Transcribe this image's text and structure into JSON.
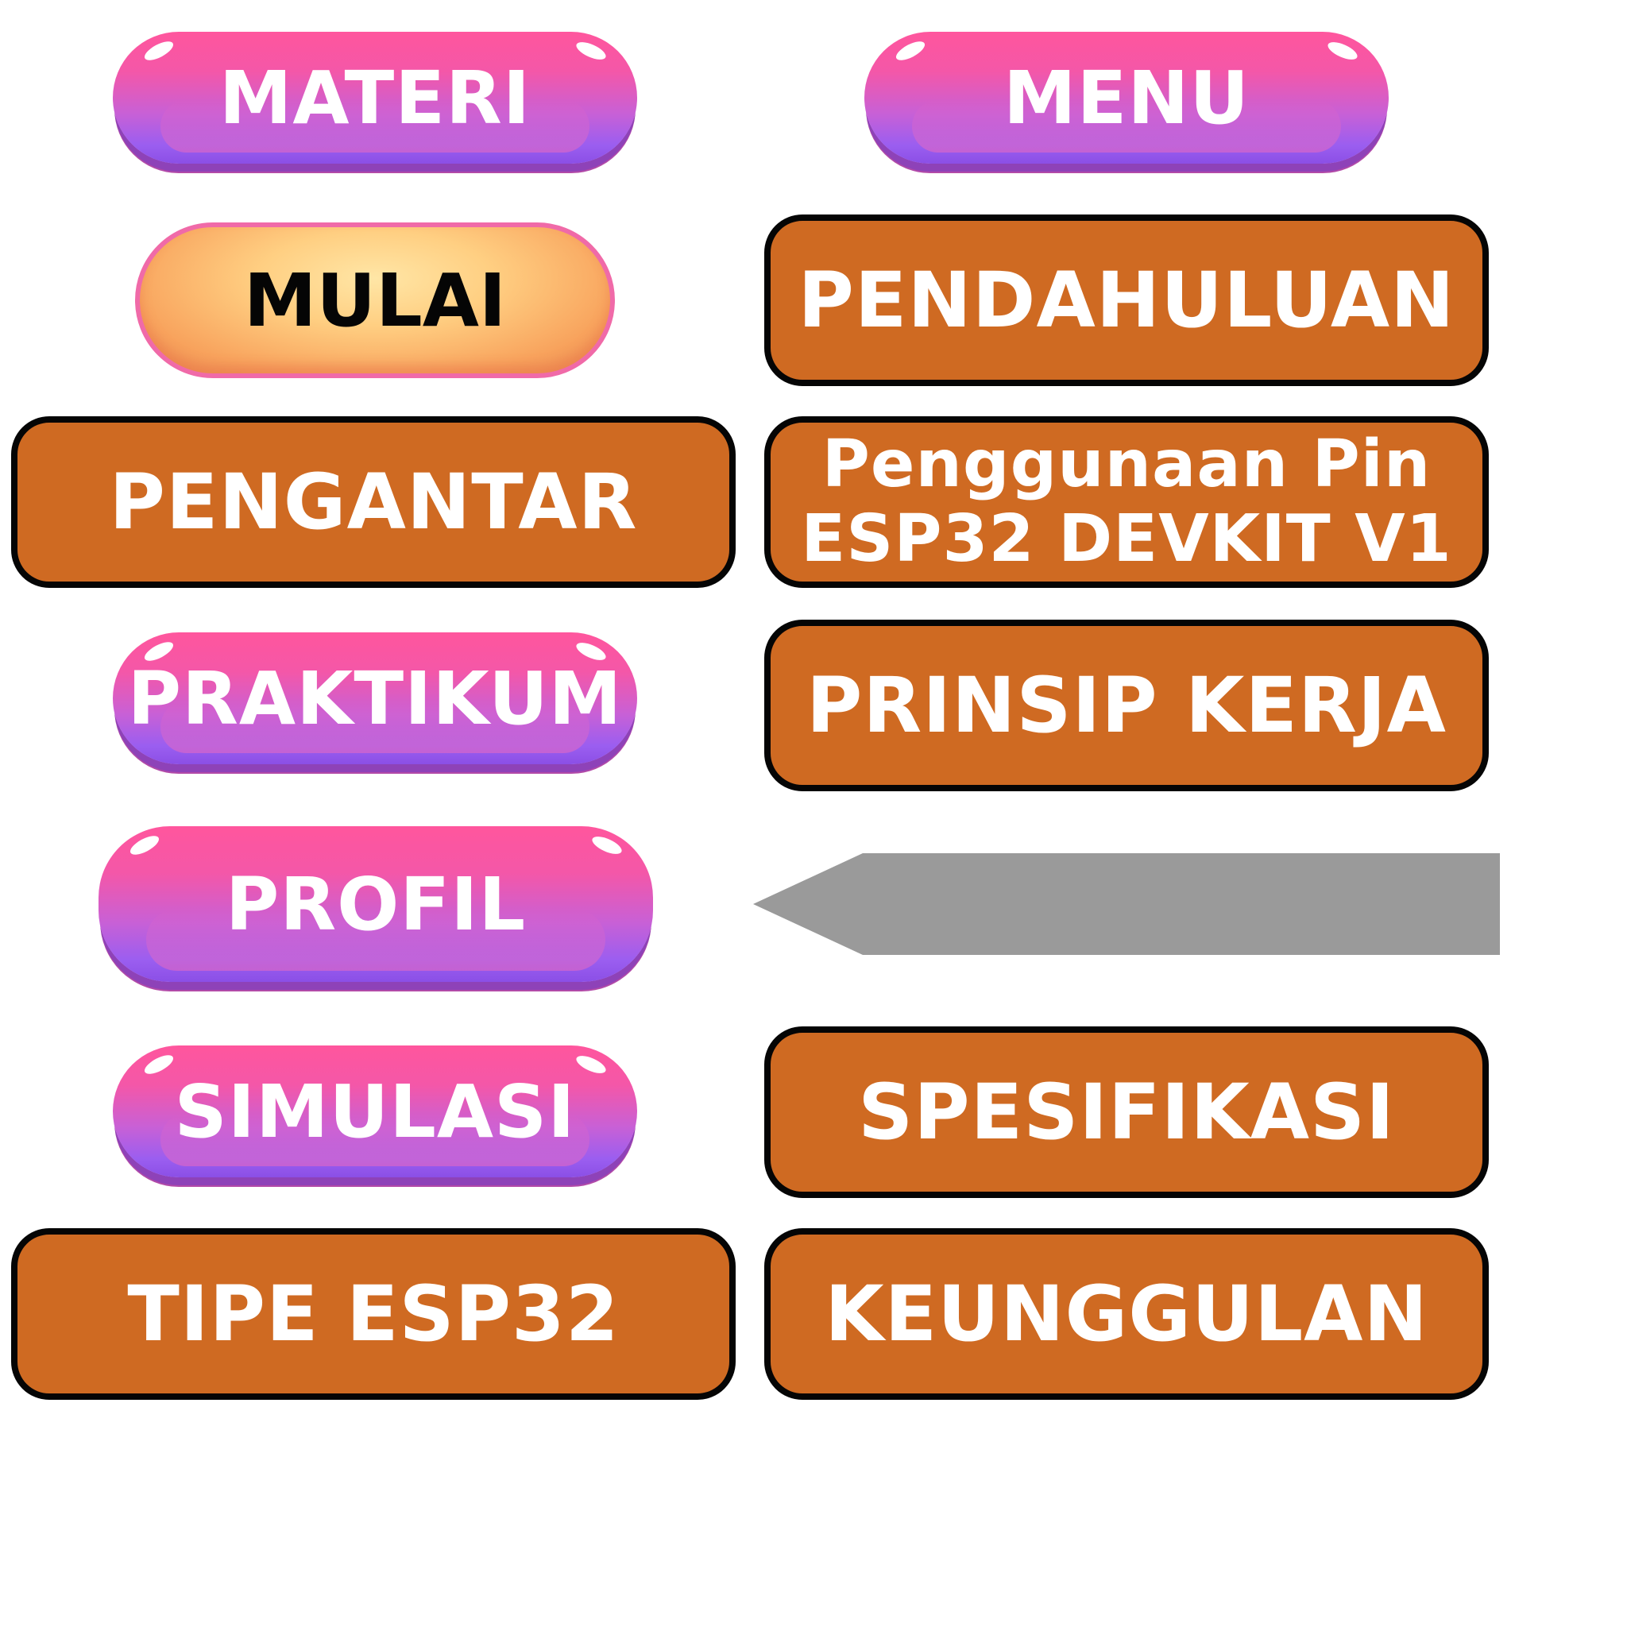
{
  "buttons": {
    "materi": "MATERI",
    "menu": "MENU",
    "mulai": "MULAI",
    "pendahuluan": "PENDAHULUAN",
    "pengantar": "PENGANTAR",
    "penggunaan_line1": "Penggunaan Pin",
    "penggunaan_line2": "ESP32 DEVKIT V1",
    "praktikum": "PRAKTIKUM",
    "prinsip_kerja": "PRINSIP KERJA",
    "profil": "PROFIL",
    "simulasi": "SIMULASI",
    "spesifikasi": "SPESIFIKASI",
    "tipe_esp32": "TIPE ESP32",
    "keunggulan": "KEUNGGULAN"
  },
  "icons": {
    "back_arrow": "left-pointer-arrow-icon"
  },
  "colors": {
    "pill_top": "#ff569d",
    "pill_bottom": "#8b4fe6",
    "box_fill": "#cf6a22",
    "box_border": "#050505",
    "mulai_fill": "#ffcf82",
    "arrow_fill": "#9a9a9a"
  }
}
